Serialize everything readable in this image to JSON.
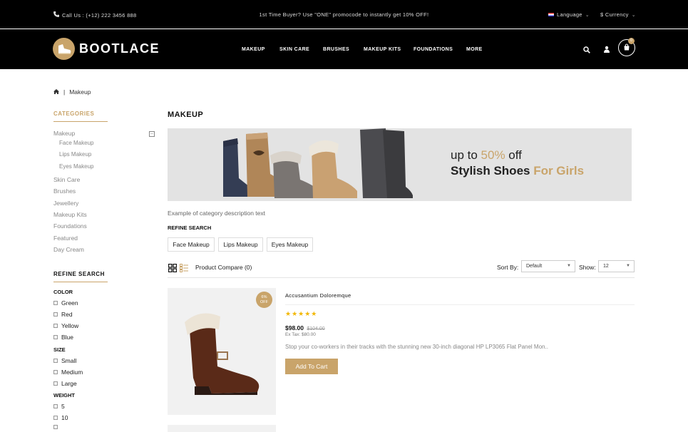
{
  "topbar": {
    "call": "Call Us : (+12) 222 3456 888",
    "promo": "1st Time Buyer? Use \"ONE\" promocode to instantly get 10% OFF!",
    "language": "Language",
    "currency": "$ Currency"
  },
  "header": {
    "logo": "BOOTLACE",
    "nav": [
      "MAKEUP",
      "SKIN CARE",
      "BRUSHES",
      "MAKEUP KITS",
      "FOUNDATIONS",
      "MORE"
    ],
    "cart_count": "0"
  },
  "breadcrumb": {
    "current": "Makeup"
  },
  "sidebar": {
    "categories_title": "CATEGORIES",
    "categories": [
      {
        "label": "Makeup",
        "sub": [
          "Face Makeup",
          "Lips Makeup",
          "Eyes Makeup"
        ]
      },
      {
        "label": "Skin Care"
      },
      {
        "label": "Brushes"
      },
      {
        "label": "Jewellery"
      },
      {
        "label": "Makeup Kits"
      },
      {
        "label": "Foundations"
      },
      {
        "label": "Featured"
      },
      {
        "label": "Day Cream"
      }
    ],
    "refine_title": "REFINE SEARCH",
    "filters": {
      "color_title": "COLOR",
      "colors": [
        "Green",
        "Red",
        "Yellow",
        "Blue"
      ],
      "size_title": "SIZE",
      "sizes": [
        "Small",
        "Medium",
        "Large"
      ],
      "weight_title": "WEIGHT",
      "weights": [
        "5",
        "10"
      ]
    }
  },
  "main": {
    "title": "MAKEUP",
    "banner": {
      "line1_prefix": "up to ",
      "line1_highlight": "50%",
      "line1_suffix": " off",
      "line2_prefix": "Stylish Shoes ",
      "line2_highlight": "For Girls"
    },
    "description": "Example of category description text",
    "refine_title": "REFINE SEARCH",
    "refine_chips": [
      "Face Makeup",
      "Lips Makeup",
      "Eyes Makeup"
    ],
    "toolbar": {
      "compare": "Product Compare (0)",
      "sort_label": "Sort By:",
      "sort_value": "Default",
      "show_label": "Show:",
      "show_value": "12"
    },
    "product": {
      "badge_line1": "6%",
      "badge_line2": "OFF",
      "name": "Accusantium Doloremque",
      "rating": 5,
      "price": "$98.00",
      "old_price": "$104.00",
      "ex_tax": "Ex Tax: $80.00",
      "description": "Stop your co-workers in their tracks with the stunning new 30-inch diagonal HP LP3065 Flat Panel Mon..",
      "add_to_cart": "Add To Cart"
    }
  },
  "colors": {
    "accent": "#c9a46a",
    "dark": "#000000",
    "star": "#f2b705"
  }
}
